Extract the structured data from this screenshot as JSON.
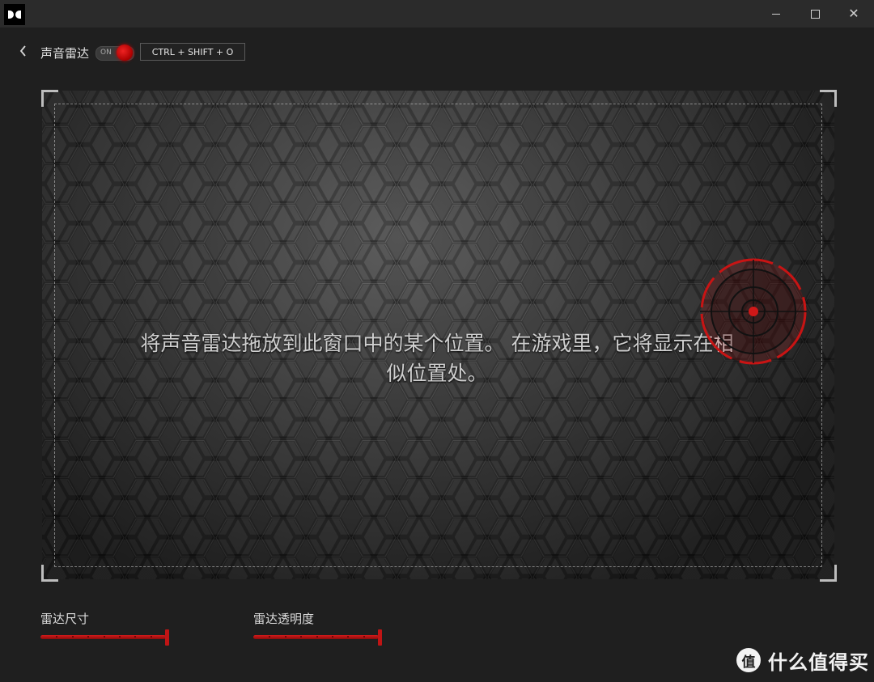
{
  "window": {
    "logo_icon": "dolby-logo-icon",
    "minimize_icon": "minimize-icon",
    "maximize_icon": "maximize-icon",
    "close_icon": "close-icon",
    "close_glyph": "✕"
  },
  "header": {
    "back_icon": "chevron-left-icon",
    "title": "声音雷达",
    "toggle_label": "ON",
    "toggle_state": "on",
    "hotkey": "CTRL + SHIFT + O"
  },
  "preview": {
    "instruction_line1": "将声音雷达拖放到此窗口中的某个位置。 在游戏里，它将显示在相",
    "instruction_line2": "似位置处。",
    "radar_icon": "radar-crosshair-icon",
    "accent_color": "#c81414"
  },
  "sliders": {
    "size": {
      "label": "雷达尺寸",
      "value_percent": 100
    },
    "opacity": {
      "label": "雷达透明度",
      "value_percent": 100
    }
  },
  "watermark": {
    "logo_glyph": "值",
    "text": "什么值得买"
  }
}
